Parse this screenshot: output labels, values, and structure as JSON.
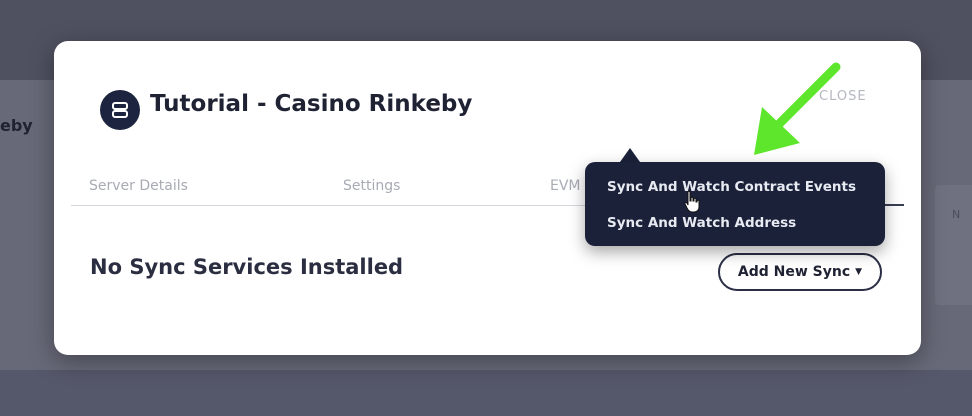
{
  "background": {
    "left_label": "eby",
    "right_label": "N"
  },
  "modal": {
    "title": "Tutorial - Casino Rinkeby",
    "close_label": "CLOSE",
    "tabs": [
      {
        "label": "Server Details"
      },
      {
        "label": "Settings"
      },
      {
        "label": "EVM"
      }
    ],
    "empty_message": "No Sync Services Installed",
    "add_button_label": "Add New Sync",
    "logo_icon": "server-logo-icon"
  },
  "dropdown": {
    "items": [
      {
        "label": "Sync And Watch Contract Events"
      },
      {
        "label": "Sync And Watch Address"
      }
    ]
  },
  "colors": {
    "modal_bg": "#ffffff",
    "dropdown_bg": "#1b2139",
    "title_text": "#1e2233",
    "annotation_arrow": "#5ee62c",
    "overlay": "#5a5c6a"
  }
}
